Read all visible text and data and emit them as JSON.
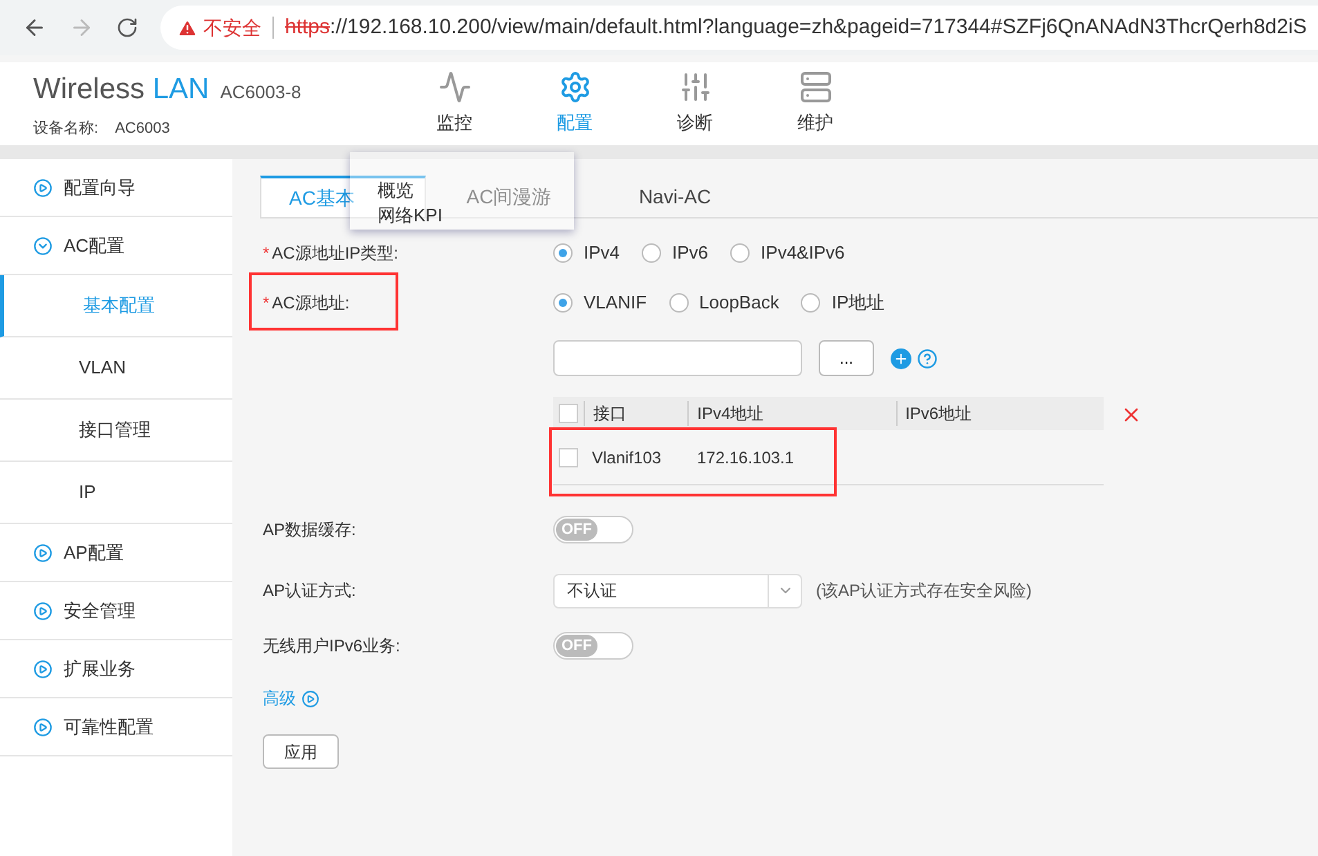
{
  "browser": {
    "security": "不安全",
    "url_scheme": "https",
    "url_rest": "://192.168.10.200/view/main/default.html?language=zh&pageid=717344#SZFj6QnANAdN3ThcrQerh8d2iS"
  },
  "header": {
    "brand": "Wireless",
    "brand_accent": "LAN",
    "model": "AC6003-8",
    "device_label": "设备名称:",
    "device_name": "AC6003"
  },
  "nav": [
    {
      "label": "监控",
      "kind": "monitor",
      "selected": false
    },
    {
      "label": "配置",
      "kind": "gear",
      "selected": true
    },
    {
      "label": "诊断",
      "kind": "sliders",
      "selected": false
    },
    {
      "label": "维护",
      "kind": "server",
      "selected": false
    }
  ],
  "nav_menu": [
    "概览",
    "网络KPI"
  ],
  "sidebar": [
    {
      "label": "配置向导",
      "expanded": false
    },
    {
      "label": "AC配置",
      "expanded": true,
      "children": [
        {
          "label": "基本配置",
          "selected": true
        },
        {
          "label": "VLAN",
          "selected": false
        },
        {
          "label": "接口管理",
          "selected": false
        },
        {
          "label": "IP",
          "selected": false
        }
      ]
    },
    {
      "label": "AP配置",
      "expanded": false
    },
    {
      "label": "安全管理",
      "expanded": false
    },
    {
      "label": "扩展业务",
      "expanded": false
    },
    {
      "label": "可靠性配置",
      "expanded": false
    }
  ],
  "tabs": [
    {
      "label": "AC基本",
      "selected": true
    },
    {
      "label": "AC间漫游",
      "selected": false
    },
    {
      "label": "Navi-AC",
      "selected": false
    }
  ],
  "ip_type": {
    "label": "AC源地址IP类型:",
    "required_mark": "*",
    "options": [
      {
        "label": "IPv4",
        "selected": true
      },
      {
        "label": "IPv6",
        "selected": false
      },
      {
        "label": "IPv4&IPv6",
        "selected": false
      }
    ]
  },
  "source": {
    "label": "AC源地址:",
    "required_mark": "*",
    "options": [
      {
        "label": "VLANIF",
        "selected": true
      },
      {
        "label": "LoopBack",
        "selected": false
      },
      {
        "label": "IP地址",
        "selected": false
      }
    ],
    "browse": "..."
  },
  "table": {
    "all_checked": false,
    "columns": [
      "接口",
      "IPv4地址",
      "IPv6地址"
    ],
    "rows": [
      {
        "checked": false,
        "cells": [
          "Vlanif103",
          "172.16.103.1",
          ""
        ]
      }
    ]
  },
  "cache": {
    "label": "AP数据缓存:",
    "on": false,
    "text": "OFF"
  },
  "auth": {
    "label": "AP认证方式:",
    "value": "不认证",
    "note": "(该AP认证方式存在安全风险)"
  },
  "ipv6": {
    "label": "无线用户IPv6业务:",
    "on": false,
    "text": "OFF"
  },
  "advanced": "高级",
  "apply": "应用"
}
